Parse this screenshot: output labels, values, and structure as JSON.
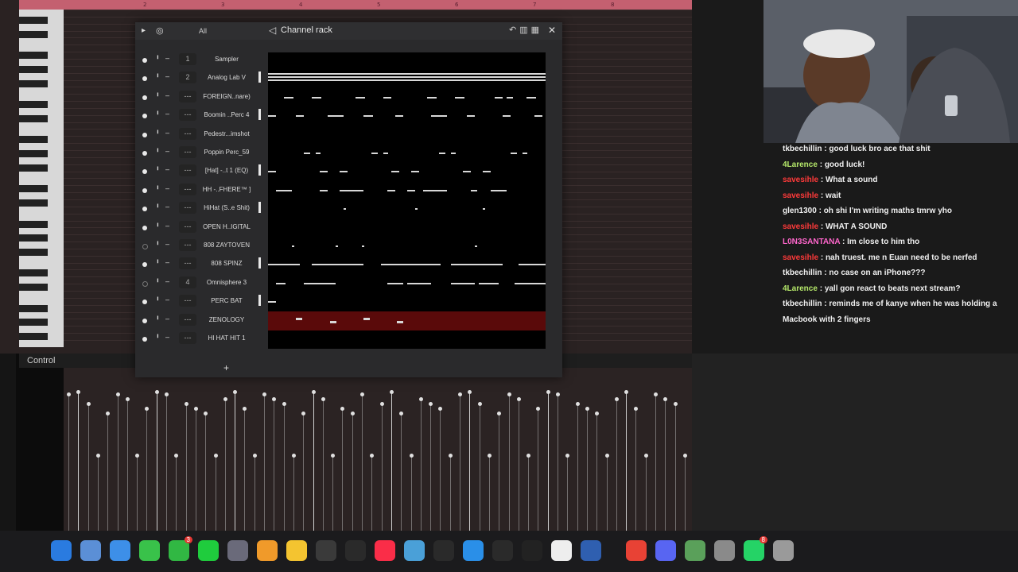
{
  "timeline": {
    "ticks": [
      "2",
      "3",
      "4",
      "5",
      "6",
      "7",
      "8"
    ]
  },
  "control": {
    "label": "Control"
  },
  "channel_rack": {
    "title": "Channel rack",
    "filter": "All",
    "channels": [
      {
        "num": "1",
        "name": "Sampler",
        "on": true
      },
      {
        "num": "2",
        "name": "Analog Lab V",
        "on": true
      },
      {
        "num": "---",
        "name": "FOREIGN..nare)",
        "on": true
      },
      {
        "num": "---",
        "name": "Boomin ..Perc 4",
        "on": true
      },
      {
        "num": "---",
        "name": "Pedestr...imshot",
        "on": true
      },
      {
        "num": "---",
        "name": "Poppin Perc_59",
        "on": true
      },
      {
        "num": "---",
        "name": "[Hat] -..t 1 (EQ)",
        "on": true
      },
      {
        "num": "---",
        "name": "HH -..FHERE™ ]",
        "on": true
      },
      {
        "num": "---",
        "name": "HiHat (S..e Shit)",
        "on": true
      },
      {
        "num": "---",
        "name": "OPEN H..IGITAL",
        "on": true
      },
      {
        "num": "---",
        "name": "808 ZAYTOVEN",
        "on": false
      },
      {
        "num": "---",
        "name": "808 SPINZ",
        "on": true
      },
      {
        "num": "4",
        "name": "Omnisphere 3",
        "on": false
      },
      {
        "num": "---",
        "name": "PERC BAT",
        "on": true
      },
      {
        "num": "---",
        "name": "ZENOLOGY",
        "on": true
      },
      {
        "num": "---",
        "name": "HI HAT HIT 1",
        "on": true
      }
    ]
  },
  "chat": [
    {
      "user": "tkbechillin",
      "color": "#f0f0f0",
      "msg": "good luck bro ace that shit"
    },
    {
      "user": "4Larence",
      "color": "#b5e86a",
      "msg": "good luck!"
    },
    {
      "user": "savesihle",
      "color": "#ff3a3a",
      "msg": "What a sound"
    },
    {
      "user": "savesihle",
      "color": "#ff3a3a",
      "msg": "wait"
    },
    {
      "user": "glen1300",
      "color": "#f0f0f0",
      "msg": "oh shi I'm writing maths tmrw yho"
    },
    {
      "user": "savesihle",
      "color": "#ff3a3a",
      "msg": "WHAT A SOUND"
    },
    {
      "user": "L0N3SANTANA",
      "color": "#ff66cc",
      "msg": "Im close to him tho"
    },
    {
      "user": "savesihle",
      "color": "#ff3a3a",
      "msg": "nah truest. me n Euan need to be nerfed"
    },
    {
      "user": "tkbechillin",
      "color": "#f0f0f0",
      "msg": "no case on an iPhone???"
    },
    {
      "user": "4Larence",
      "color": "#b5e86a",
      "msg": "yall gon react to beats next stream?"
    },
    {
      "user": "tkbechillin",
      "color": "#f0f0f0",
      "msg": "reminds me of kanye when he was holding a Macbook with 2 fingers"
    }
  ],
  "dock": {
    "icons": [
      {
        "name": "finder-icon",
        "color": "#2a7be0"
      },
      {
        "name": "files-icon",
        "color": "#5b8fd6"
      },
      {
        "name": "safari-icon",
        "color": "#3d8fe8"
      },
      {
        "name": "messages-icon",
        "color": "#39c24a"
      },
      {
        "name": "facetime-icon",
        "color": "#31b843",
        "badge": "3"
      },
      {
        "name": "kick-icon",
        "color": "#1fcc3d"
      },
      {
        "name": "obs-icon",
        "color": "#6a6a7a"
      },
      {
        "name": "fl-studio-icon",
        "color": "#f09a2a"
      },
      {
        "name": "notes-icon",
        "color": "#f4c430"
      },
      {
        "name": "pen-icon",
        "color": "#3a3a3a"
      },
      {
        "name": "capcut-icon",
        "color": "#2a2a2a"
      },
      {
        "name": "music-icon",
        "color": "#fa2d48"
      },
      {
        "name": "davinci-icon",
        "color": "#4aa0d8"
      },
      {
        "name": "github-icon",
        "color": "#2a2a2a"
      },
      {
        "name": "vscode-icon",
        "color": "#2a8fe8"
      },
      {
        "name": "chatgpt-icon",
        "color": "#2a2a2a"
      },
      {
        "name": "capcut2-icon",
        "color": "#222222"
      },
      {
        "name": "notion-icon",
        "color": "#eeeeee"
      },
      {
        "name": "virtualbox-icon",
        "color": "#2f5fb0"
      },
      {
        "name": "chrome-icon",
        "color": "#e84235"
      },
      {
        "name": "discord-icon",
        "color": "#5865f2"
      },
      {
        "name": "utility-icon",
        "color": "#5aa05a"
      },
      {
        "name": "settings-icon",
        "color": "#8a8a8a"
      },
      {
        "name": "whatsapp-icon",
        "color": "#25d366",
        "badge": "8"
      },
      {
        "name": "trash-icon",
        "color": "#9a9a9a"
      }
    ]
  }
}
